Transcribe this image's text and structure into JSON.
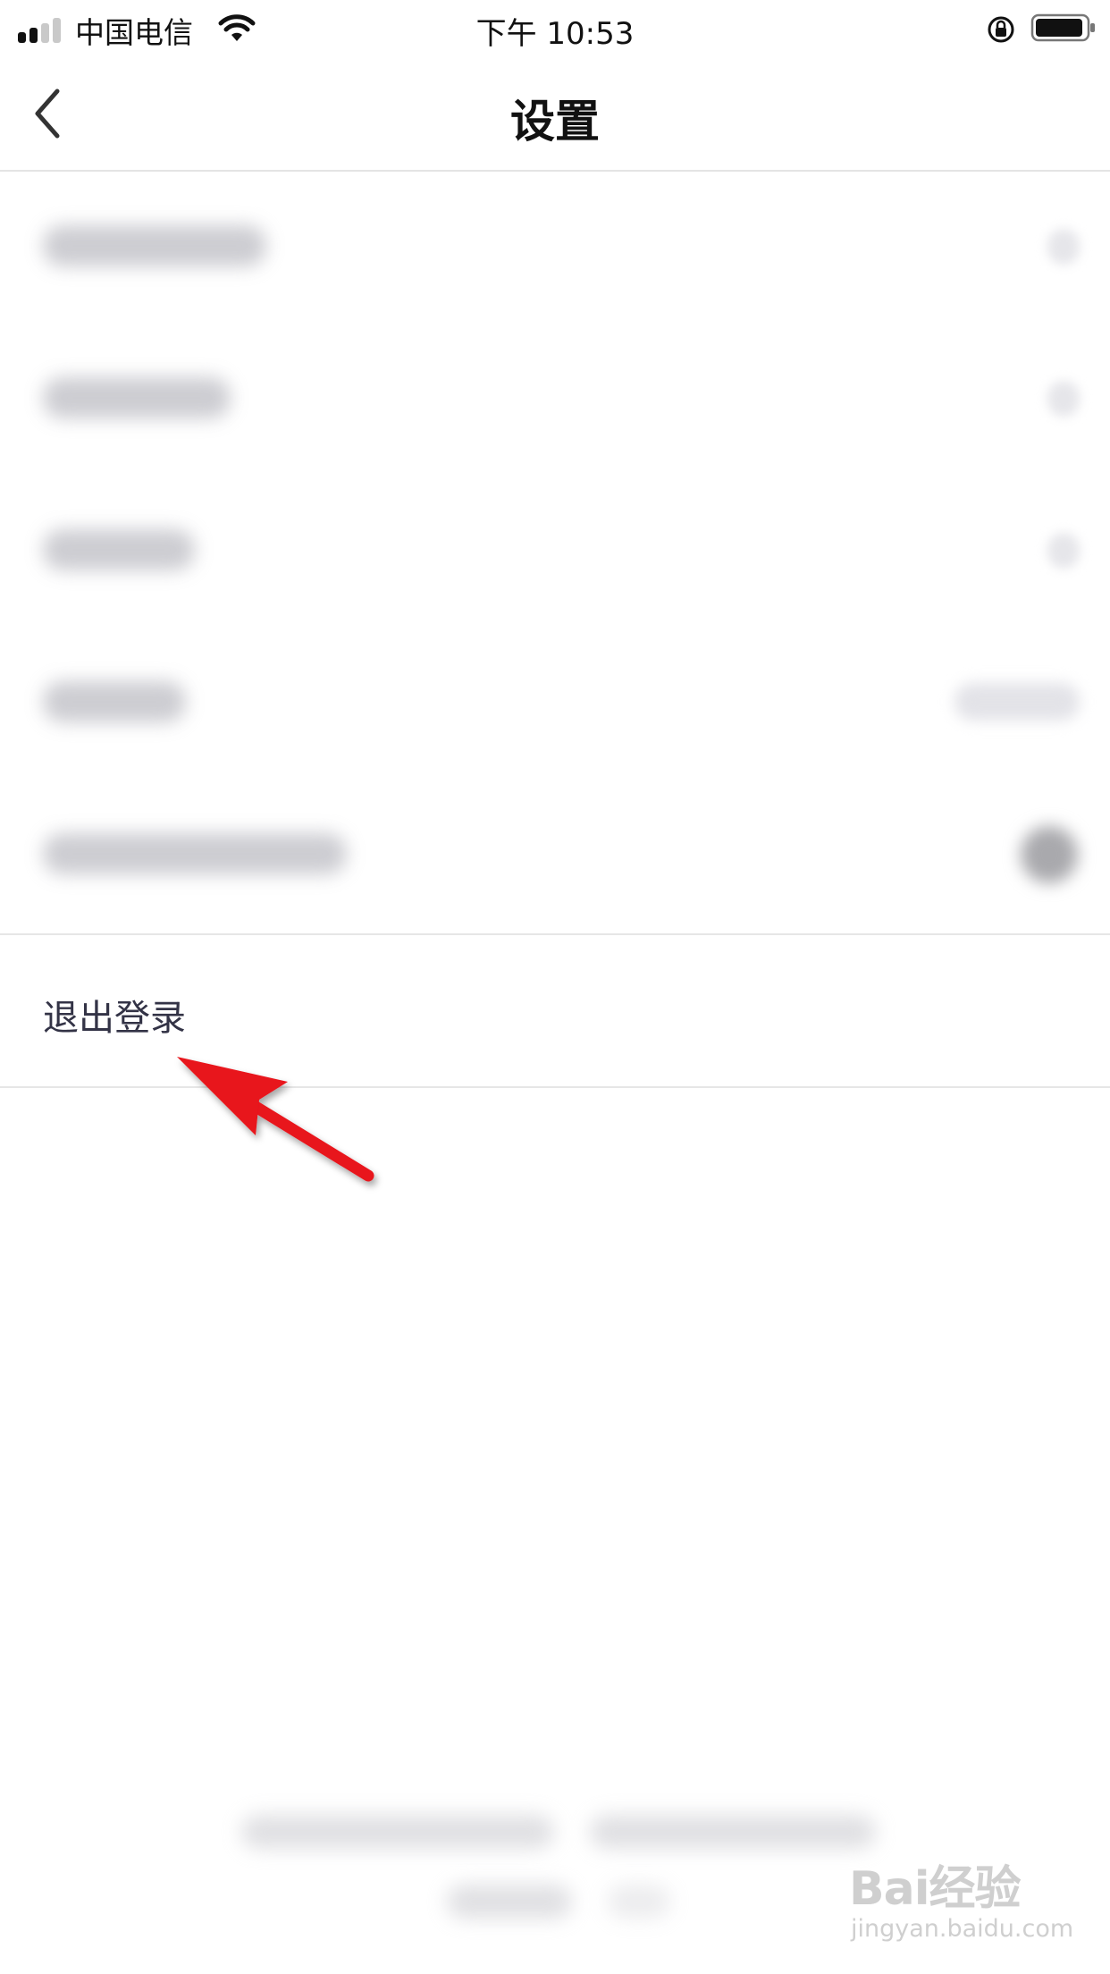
{
  "status_bar": {
    "carrier": "中国电信",
    "time": "下午 10:53",
    "signal_bars": 4,
    "signal_active": 2,
    "icons": [
      "signal-icon",
      "wifi-icon",
      "orientation-lock-icon",
      "battery-icon"
    ],
    "battery_level": 0.9
  },
  "nav": {
    "title": "设置",
    "back_icon": "chevron-left-icon"
  },
  "settings_rows": [
    {
      "content": "blurred",
      "trailing": "chevron-right-icon"
    },
    {
      "content": "blurred",
      "trailing": "chevron-right-icon"
    },
    {
      "content": "blurred",
      "trailing": "chevron-right-icon"
    },
    {
      "content": "blurred",
      "trailing": "value"
    },
    {
      "content": "blurred",
      "trailing": "toggle"
    }
  ],
  "logout": {
    "label": "退出登录"
  },
  "annotation": {
    "icon": "red-arrow-icon",
    "color": "#e8121b"
  },
  "watermark": {
    "brand": "Bai经验",
    "url": "jingyan.baidu.com"
  },
  "colors": {
    "divider": "#e6e6e6",
    "logout_text": "#333346",
    "background": "#ffffff"
  }
}
